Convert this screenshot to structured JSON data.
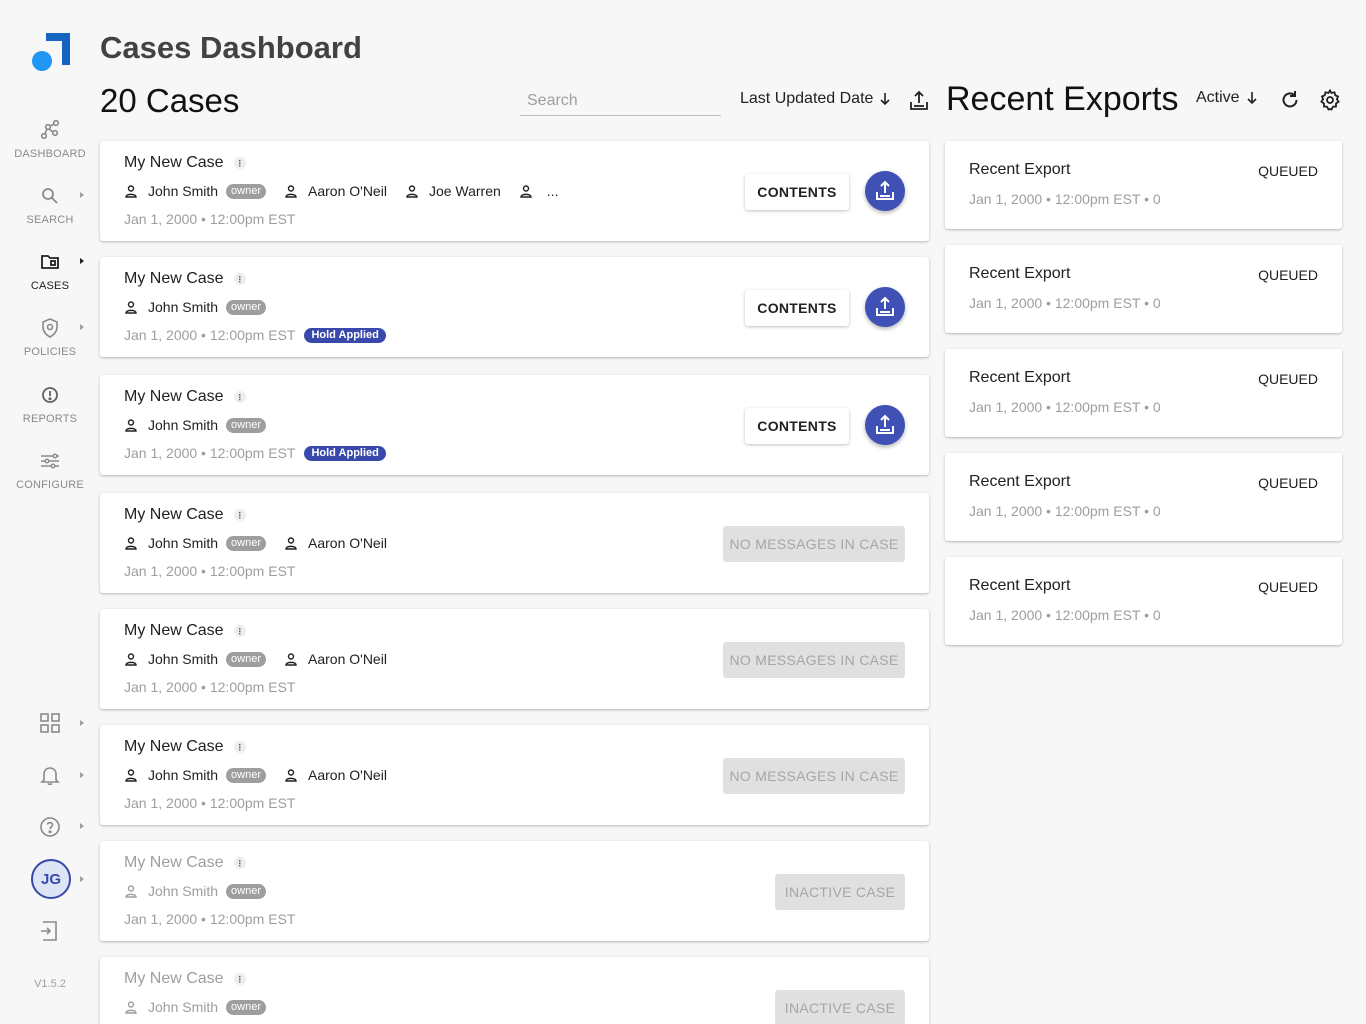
{
  "app": {
    "page_title": "Cases Dashboard",
    "version": "V1.5.2",
    "accent": "#3f51b5"
  },
  "nav": [
    {
      "label": "DASHBOARD",
      "icon": "graph-nodes-icon"
    },
    {
      "label": "SEARCH",
      "icon": "search-icon"
    },
    {
      "label": "CASES",
      "icon": "folder-icon"
    },
    {
      "label": "POLICIES",
      "icon": "shield-icon"
    },
    {
      "label": "REPORTS",
      "icon": "alert-circle-icon"
    },
    {
      "label": "CONFIGURE",
      "icon": "sliders-icon"
    }
  ],
  "user": {
    "initials": "JG"
  },
  "cases_header": {
    "count_label": "20 Cases",
    "search_placeholder": "Search",
    "sort_label": "Last Updated Date"
  },
  "exports_header": {
    "title": "Recent Exports",
    "filter_label": "Active"
  },
  "labels": {
    "owner": "owner",
    "hold": "Hold Applied",
    "contents": "CONTENTS",
    "no_messages": "NO MESSAGES IN CASE",
    "inactive": "INACTIVE CASE",
    "more": "..."
  },
  "cases": [
    {
      "name": "My New Case",
      "owner": "John Smith",
      "others": [
        "Aaron O'Neil",
        "Joe Warren"
      ],
      "meta": "Jan 1, 2000 • 12:00pm EST"
    },
    {
      "name": "My New Case",
      "owner": "John Smith",
      "meta": "Jan 1, 2000 • 12:00pm EST"
    },
    {
      "name": "My New Case",
      "owner": "John Smith",
      "meta": "Jan 1, 2000 • 12:00pm EST"
    },
    {
      "name": "My New Case",
      "owner": "John Smith",
      "others": [
        "Aaron O'Neil"
      ],
      "meta": "Jan 1, 2000 • 12:00pm EST"
    },
    {
      "name": "My New Case",
      "owner": "John Smith",
      "others": [
        "Aaron O'Neil"
      ],
      "meta": "Jan 1, 2000 • 12:00pm EST"
    },
    {
      "name": "My New Case",
      "owner": "John Smith",
      "others": [
        "Aaron O'Neil"
      ],
      "meta": "Jan 1, 2000 • 12:00pm EST"
    },
    {
      "name": "My New Case",
      "owner": "John Smith",
      "meta": "Jan 1, 2000 • 12:00pm EST"
    },
    {
      "name": "My New Case",
      "owner": "John Smith"
    }
  ],
  "exports": [
    {
      "name": "Recent Export",
      "status": "QUEUED",
      "meta": "Jan 1, 2000 • 12:00pm EST • 0"
    },
    {
      "name": "Recent Export",
      "status": "QUEUED",
      "meta": "Jan 1, 2000 • 12:00pm EST • 0"
    },
    {
      "name": "Recent Export",
      "status": "QUEUED",
      "meta": "Jan 1, 2000 • 12:00pm EST • 0"
    },
    {
      "name": "Recent Export",
      "status": "QUEUED",
      "meta": "Jan 1, 2000 • 12:00pm EST • 0"
    },
    {
      "name": "Recent Export",
      "status": "QUEUED",
      "meta": "Jan 1, 2000 • 12:00pm EST • 0"
    }
  ]
}
